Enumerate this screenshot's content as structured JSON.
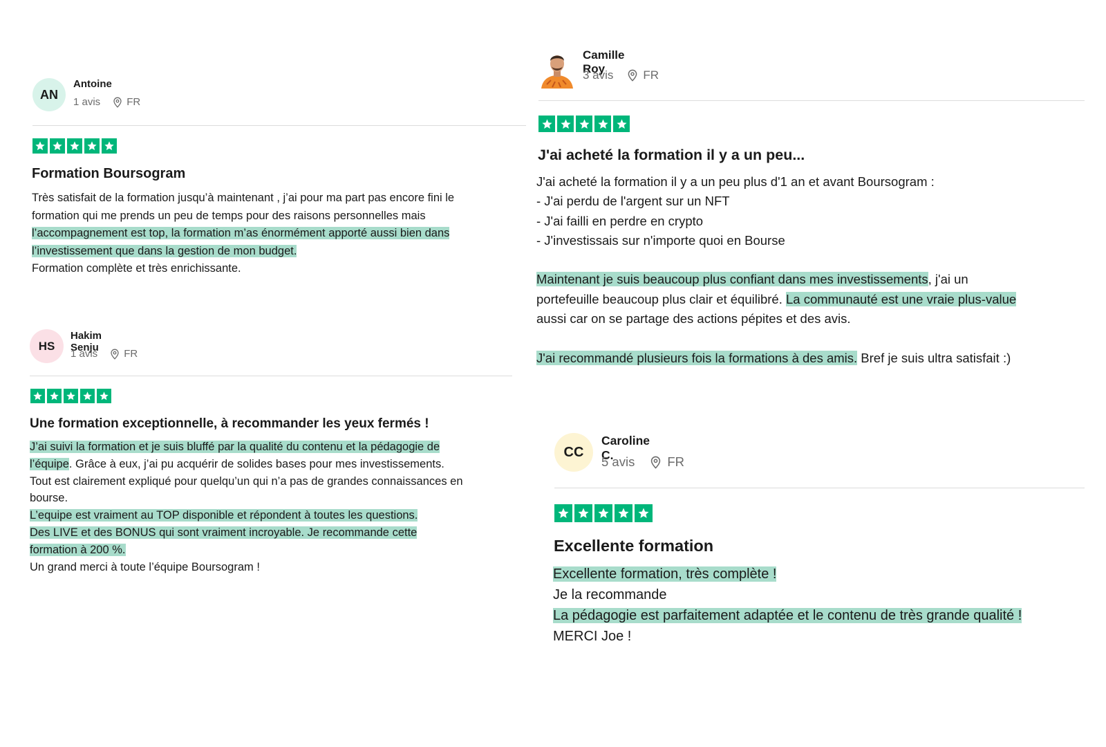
{
  "reviews": [
    {
      "initials": "AN",
      "avatar_color": "#d8f3ea",
      "name": "Antoine",
      "count": "1 avis",
      "country": "FR",
      "title": "Formation Boursogram",
      "body": [
        [
          {
            "t": "Très satisfait de la formation jusqu’à maintenant , j’ai pour ma part pas encore fini le",
            "h": false
          }
        ],
        [
          {
            "t": "formation qui me prends un peu de temps pour des raisons personnelles mais",
            "h": false
          }
        ],
        [
          {
            "t": "l’accompagnement est top, la formation m’as énormément apporté aussi bien dans",
            "h": true
          }
        ],
        [
          {
            "t": "l’investissement que dans la gestion de mon budget.",
            "h": true
          }
        ],
        [
          {
            "t": "Formation complète et très enrichissante.",
            "h": false
          }
        ]
      ]
    },
    {
      "initials": "HS",
      "avatar_color": "#fbe0e6",
      "name": "Hakim Senju",
      "count": "1 avis",
      "country": "FR",
      "title": "Une formation exceptionnelle, à recommander les yeux fermés !",
      "body": [
        [
          {
            "t": "J’ai suivi la formation et je suis bluffé par la qualité du contenu et la pédagogie de",
            "h": true
          }
        ],
        [
          {
            "t": "l’équipe",
            "h": true
          },
          {
            "t": ". Grâce à eux, j’ai pu acquérir de solides bases pour mes investissements.",
            "h": false
          }
        ],
        [
          {
            "t": "Tout est clairement expliqué pour quelqu’un qui n’a pas de grandes connaissances en",
            "h": false
          }
        ],
        [
          {
            "t": "bourse.",
            "h": false
          }
        ],
        [
          {
            "t": "L’equipe est vraiment au TOP disponible et répondent à toutes les questions.",
            "h": true
          }
        ],
        [
          {
            "t": "Des LIVE et des BONUS qui sont vraiment incroyable. Je recommande cette",
            "h": true
          }
        ],
        [
          {
            "t": "formation à 200 %.",
            "h": true
          }
        ],
        [
          {
            "t": "Un grand merci à toute l’équipe Boursogram !",
            "h": false
          }
        ]
      ]
    },
    {
      "name": "Camille Roy",
      "count": "3 avis",
      "country": "FR",
      "title": "J'ai acheté la formation il y a un peu...",
      "body": [
        [
          {
            "t": "J'ai acheté la formation il y a un peu plus d'1 an et avant Boursogram :",
            "h": false
          }
        ],
        [
          {
            "t": "- J'ai perdu de l'argent sur un NFT",
            "h": false
          }
        ],
        [
          {
            "t": "- J'ai failli en perdre en crypto",
            "h": false
          }
        ],
        [
          {
            "t": "- J'investissais sur n'importe quoi en Bourse",
            "h": false
          }
        ],
        [],
        [
          {
            "t": "Maintenant je suis beaucoup plus confiant dans mes investissements",
            "h": true
          },
          {
            "t": ", j'ai un",
            "h": false
          }
        ],
        [
          {
            "t": "portefeuille beaucoup plus clair et équilibré. ",
            "h": false
          },
          {
            "t": "La communauté est une vraie plus-value",
            "h": true
          }
        ],
        [
          {
            "t": "aussi car on se partage des actions pépites et des avis.",
            "h": false
          }
        ],
        [],
        [
          {
            "t": "J'ai recommandé plusieurs fois la formations à des amis.",
            "h": true
          },
          {
            "t": " Bref je suis ultra satisfait :)",
            "h": false
          }
        ]
      ]
    },
    {
      "initials": "CC",
      "avatar_color": "#fdf4d3",
      "name": "Caroline C.",
      "count": "5 avis",
      "country": "FR",
      "title": "Excellente formation",
      "body": [
        [
          {
            "t": "Excellente formation, très complète !",
            "h": true
          }
        ],
        [
          {
            "t": "Je la recommande",
            "h": false
          }
        ],
        [
          {
            "t": "La pédagogie est parfaitement adaptée et le contenu de très grande qualité !",
            "h": true
          }
        ],
        [
          {
            "t": "MERCI Joe !",
            "h": false
          }
        ]
      ]
    }
  ],
  "colors": {
    "star_green": "#00b67a",
    "highlight": "#a8dccb"
  },
  "icons": {
    "location": "map-pin-icon",
    "star": "star-icon"
  }
}
